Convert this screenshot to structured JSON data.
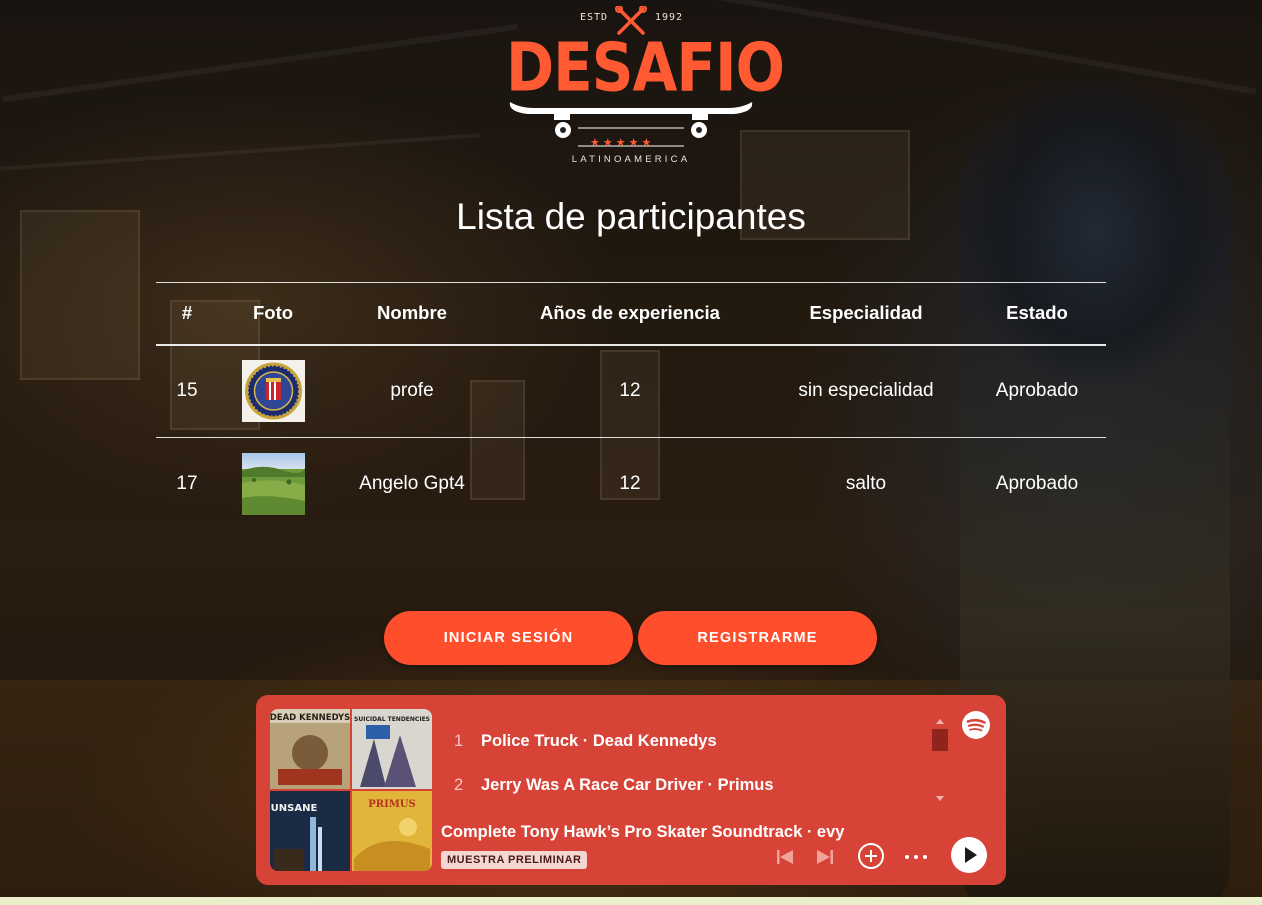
{
  "logo": {
    "estd": "ESTD",
    "year": "1992",
    "title": "DESAFIO",
    "stars": "★★★★★",
    "subtitle": "LATINOAMERICA"
  },
  "page_title": "Lista de participantes",
  "table": {
    "headers": [
      "#",
      "Foto",
      "Nombre",
      "Años de experiencia",
      "Especialidad",
      "Estado"
    ],
    "rows": [
      {
        "id": "15",
        "photo": "fbi-seal",
        "nombre": "profe",
        "anos": "12",
        "especialidad": "sin especialidad",
        "estado": "Aprobado"
      },
      {
        "id": "17",
        "photo": "green-landscape",
        "nombre": "Angelo Gpt4",
        "anos": "12",
        "especialidad": "salto",
        "estado": "Aprobado"
      }
    ]
  },
  "buttons": {
    "login": "INICIAR SESIÓN",
    "register": "REGISTRARME"
  },
  "player": {
    "tracks": [
      {
        "num": "1",
        "title": "Police Truck · Dead Kennedys"
      },
      {
        "num": "2",
        "title": "Jerry Was A Race Car Driver · Primus"
      }
    ],
    "playlist_title": "Complete Tony Hawk’s Pro Skater Soundtrack · evy",
    "preview_label": "MUESTRA PRELIMINAR",
    "cover_labels": [
      "DEAD KENNEDYS",
      "SUICIDAL TENDENCIES",
      "UNSANE",
      "PRIMUS"
    ],
    "controls": [
      "previous-icon",
      "next-icon",
      "add-icon",
      "more-icon",
      "play-icon"
    ],
    "colors": {
      "background": "#d84338",
      "accent": "#ff4e2c"
    }
  }
}
